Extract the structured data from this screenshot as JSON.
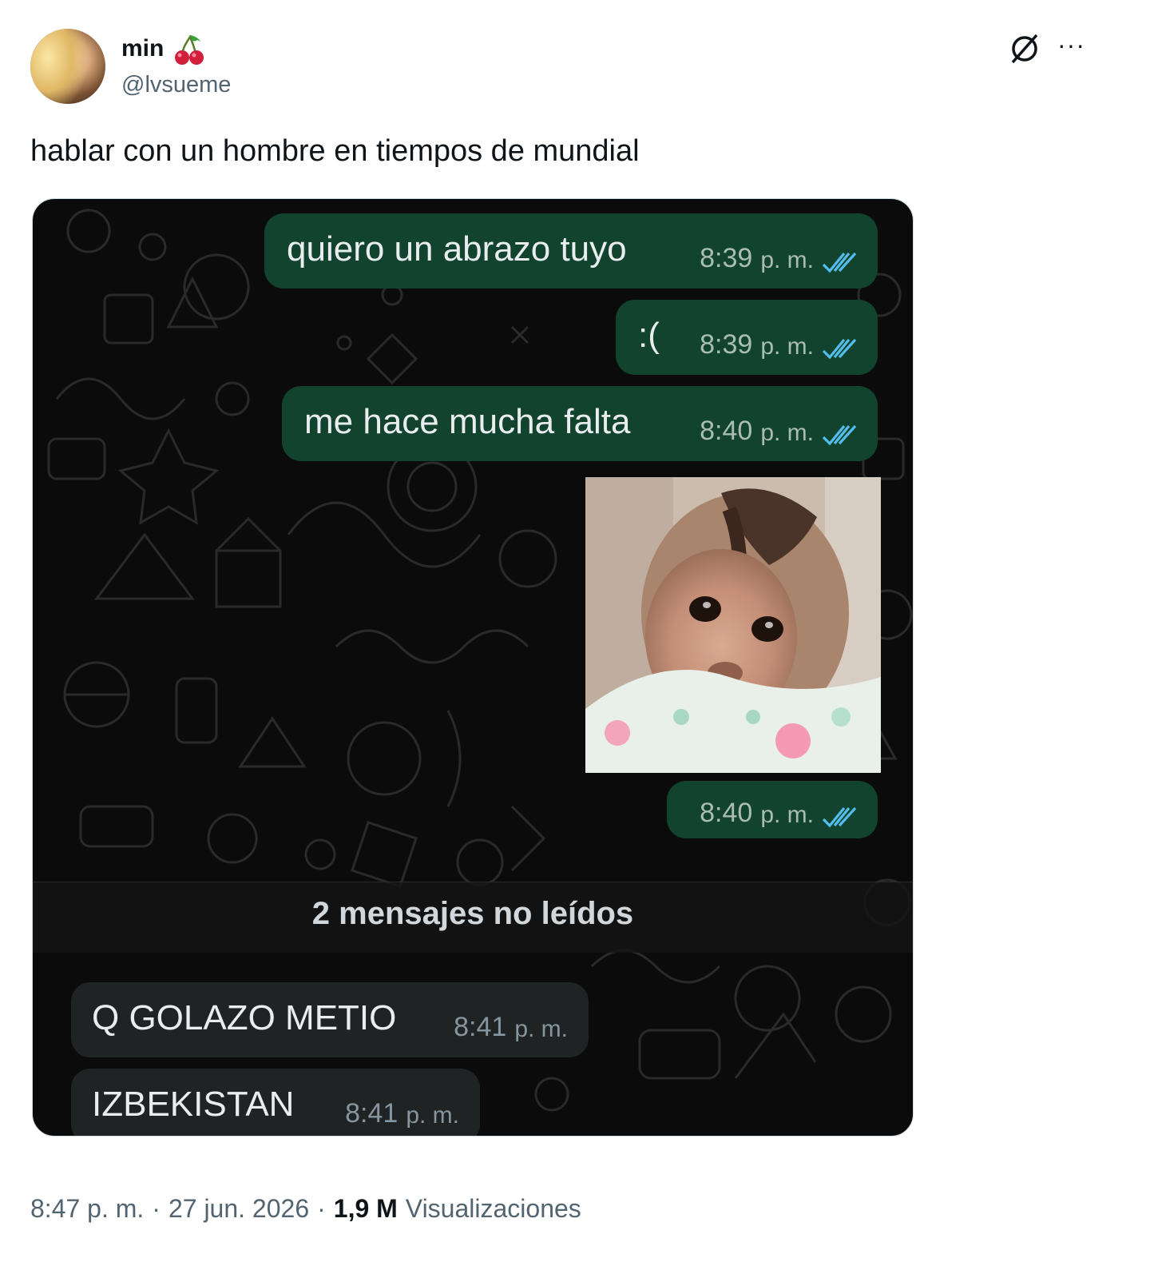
{
  "author": {
    "name": "min",
    "handle": "@lvsueme",
    "avatar_icon": "profile-photo",
    "badge_icon": "cherry-emoji"
  },
  "tweet": {
    "text": "hablar con un hombre en tiempos de mundial"
  },
  "chat": {
    "outgoing_color": "#11432f",
    "incoming_color": "#202324",
    "tick_color": "#53bdeb",
    "messages_out": [
      {
        "text": "quiero un abrazo tuyo",
        "time": "8:39",
        "ampm": "p. m."
      },
      {
        "text": ":(",
        "time": "8:39",
        "ampm": "p. m."
      },
      {
        "text": "me hace mucha falta",
        "time": "8:40",
        "ampm": "p. m."
      }
    ],
    "image_message": {
      "time": "8:40",
      "ampm": "p. m.",
      "image": "crying-monkey-sticker"
    },
    "unread_divider": "2 mensajes no leídos",
    "messages_in": [
      {
        "text": "Q GOLAZO METIO",
        "time": "8:41",
        "ampm": "p. m."
      },
      {
        "text": "IZBEKISTAN",
        "time": "8:41",
        "ampm": "p. m."
      }
    ]
  },
  "footer": {
    "time": "8:47 p. m.",
    "sep1": "·",
    "date": "27 jun. 2026",
    "sep2": "·",
    "views_count": "1,9 M",
    "views_label": "Visualizaciones"
  },
  "icons": {
    "grok": "grok-icon",
    "more": "more-options-icon"
  }
}
